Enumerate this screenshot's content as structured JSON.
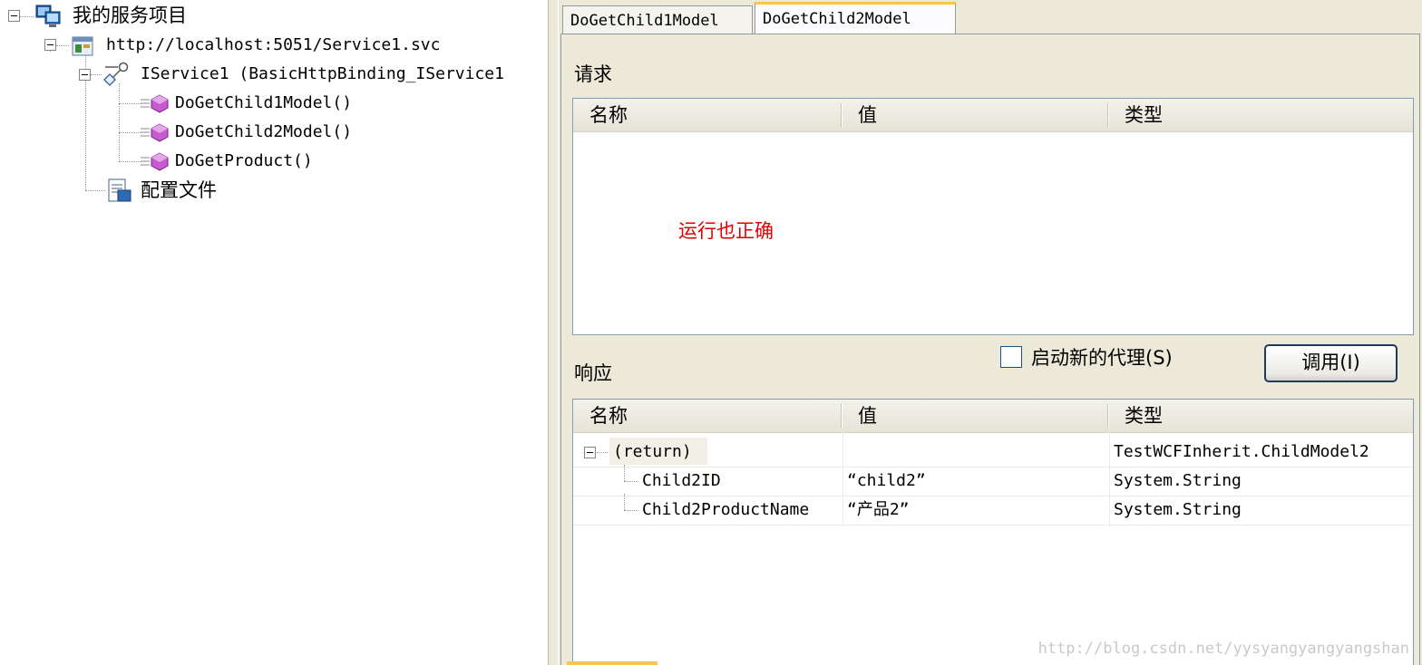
{
  "tree": {
    "root_label": "我的服务项目",
    "service_url": "http://localhost:5051/Service1.svc",
    "contract_label": "IService1 (BasicHttpBinding_IService1",
    "methods": [
      "DoGetChild1Model()",
      "DoGetChild2Model()",
      "DoGetProduct()"
    ],
    "config_label": "配置文件"
  },
  "tabs": [
    {
      "label": "DoGetChild1Model",
      "active": false
    },
    {
      "label": "DoGetChild2Model",
      "active": true
    }
  ],
  "request": {
    "label": "请求",
    "columns": [
      "名称",
      "值",
      "类型"
    ],
    "note": "运行也正确"
  },
  "start_new_proxy": {
    "label": "启动新的代理(S)",
    "checked": false
  },
  "invoke_button": "调用(I)",
  "response": {
    "label": "响应",
    "columns": [
      "名称",
      "值",
      "类型"
    ],
    "rows": [
      {
        "name": "(return)",
        "value": "",
        "type": "TestWCFInherit.ChildModel2"
      },
      {
        "name": "Child2ID",
        "value": "“child2”",
        "type": "System.String"
      },
      {
        "name": "Child2ProductName",
        "value": "“产品2”",
        "type": "System.String"
      }
    ]
  },
  "watermark": "http://blog.csdn.net/yysyangyangyangshan",
  "colors": {
    "panel_bg": "#ece9d8",
    "active_tab_accent": "#ffc83c",
    "note_red": "#e00000",
    "method_icon": "#c85ad2"
  }
}
